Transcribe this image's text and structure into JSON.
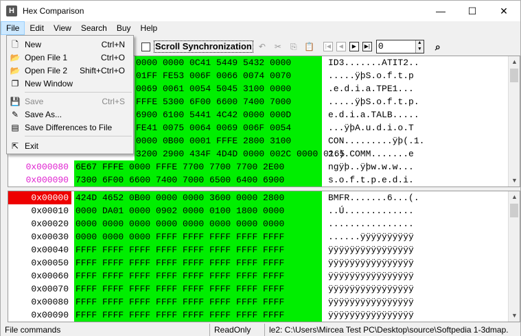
{
  "window": {
    "title": "Hex Comparison",
    "app_icon": "hex-icon",
    "controls": {
      "minimize": "—",
      "maximize": "☐",
      "close": "✕"
    }
  },
  "menubar": [
    {
      "label": "File"
    },
    {
      "label": "Edit"
    },
    {
      "label": "View"
    },
    {
      "label": "Search"
    },
    {
      "label": "Buy"
    },
    {
      "label": "Help"
    }
  ],
  "file_menu": [
    {
      "label": "New",
      "shortcut": "Ctrl+N",
      "icon": "new-file-icon",
      "glyph": "🗋"
    },
    {
      "label": "Open File 1",
      "shortcut": "Ctrl+O",
      "icon": "open-folder-icon",
      "glyph": "📂"
    },
    {
      "label": "Open File 2",
      "shortcut": "Shift+Ctrl+O",
      "icon": "open-folder-icon",
      "glyph": "📂"
    },
    {
      "label": "New Window",
      "shortcut": "",
      "icon": "new-window-icon",
      "glyph": "❐"
    },
    {
      "label": "Save",
      "shortcut": "Ctrl+S",
      "icon": "save-icon",
      "glyph": "💾",
      "disabled": true
    },
    {
      "label": "Save As...",
      "shortcut": "",
      "icon": "save-as-icon",
      "glyph": "✎"
    },
    {
      "label": "Save Differences to File",
      "shortcut": "",
      "icon": "save-diff-icon",
      "glyph": "▤"
    },
    {
      "label": "Exit",
      "shortcut": "",
      "icon": "exit-icon",
      "glyph": "⇱"
    }
  ],
  "toolbar": {
    "scroll_sync_label": "Scroll Synchronization",
    "offset_value": "0"
  },
  "pane1_rows": [
    {
      "addr": "",
      "hex": "0000 0000 0C41 5449 5432 0000",
      "ascii": "ID3.......ATIT2.."
    },
    {
      "addr": "",
      "hex": "01FF FE53 006F 0066 0074 0070",
      "ascii": ".....ÿþS.o.f.t.p"
    },
    {
      "addr": "",
      "hex": "0069 0061 0054 5045 3100 0000",
      "ascii": ".e.d.i.a.TPE1..."
    },
    {
      "addr": "",
      "hex": "FFFE 5300 6F00 6600 7400 7000",
      "ascii": ".....ÿþS.o.f.t.p."
    },
    {
      "addr": "",
      "hex": "6900 6100 5441 4C42 0000 000D",
      "ascii": "e.d.i.a.TALB....."
    },
    {
      "addr": "",
      "hex": "FE41 0075 0064 0069 006F 0054",
      "ascii": "...ÿþA.u.d.i.o.T"
    },
    {
      "addr": "",
      "hex": "0000 0B00 0001 FFFE 2800 3100",
      "ascii": "CON.........ÿþ(.1."
    },
    {
      "addr": "",
      "hex": "3200 2900 434F 4D4D 0000 002C 0000 0165",
      "ascii": "2.).COMM.......e"
    },
    {
      "addr": "0x000080",
      "hex": "6E67 FFFE 0000 FFFE 7700 7700 7700 2E00",
      "ascii": "ngÿþ..ÿþw.w.w..."
    },
    {
      "addr": "0x000090",
      "hex": "7300 6F00 6600 7400 7000 6500 6400 6900",
      "ascii": "s.o.f.t.p.e.d.i."
    }
  ],
  "pane2_rows": [
    {
      "addr": "0x00000",
      "hex": "424D 4652 0B00 0000 0000 3600 0000 2800",
      "ascii": "BMFR.......6...(."
    },
    {
      "addr": "0x00010",
      "hex": "0000 DA01 0000 0902 0000 0100 1800 0000",
      "ascii": "..Ú............."
    },
    {
      "addr": "0x00020",
      "hex": "0000 0000 0000 0000 0000 0000 0000 0000",
      "ascii": "................"
    },
    {
      "addr": "0x00030",
      "hex": "0000 0000 0000 FFFF FFFF FFFF FFFF FFFF",
      "ascii": "......ÿÿÿÿÿÿÿÿÿÿ"
    },
    {
      "addr": "0x00040",
      "hex": "FFFF FFFF FFFF FFFF FFFF FFFF FFFF FFFF",
      "ascii": "ÿÿÿÿÿÿÿÿÿÿÿÿÿÿÿÿ"
    },
    {
      "addr": "0x00050",
      "hex": "FFFF FFFF FFFF FFFF FFFF FFFF FFFF FFFF",
      "ascii": "ÿÿÿÿÿÿÿÿÿÿÿÿÿÿÿÿ"
    },
    {
      "addr": "0x00060",
      "hex": "FFFF FFFF FFFF FFFF FFFF FFFF FFFF FFFF",
      "ascii": "ÿÿÿÿÿÿÿÿÿÿÿÿÿÿÿÿ"
    },
    {
      "addr": "0x00070",
      "hex": "FFFF FFFF FFFF FFFF FFFF FFFF FFFF FFFF",
      "ascii": "ÿÿÿÿÿÿÿÿÿÿÿÿÿÿÿÿ"
    },
    {
      "addr": "0x00080",
      "hex": "FFFF FFFF FFFF FFFF FFFF FFFF FFFF FFFF",
      "ascii": "ÿÿÿÿÿÿÿÿÿÿÿÿÿÿÿÿ"
    },
    {
      "addr": "0x00090",
      "hex": "FFFF FFFF FFFF FFFF FFFF FFFF FFFF FFFF",
      "ascii": "ÿÿÿÿÿÿÿÿÿÿÿÿÿÿÿÿ"
    }
  ],
  "statusbar": {
    "left": "File commands",
    "mode": "ReadOnly",
    "path": "le2: C:\\Users\\Mircea Test PC\\Desktop\\source\\Softpedia 1-3dmap."
  },
  "colors": {
    "match": "#00ee00",
    "selected_addr": "#ee0000",
    "pink_addr": "#e020d0"
  }
}
